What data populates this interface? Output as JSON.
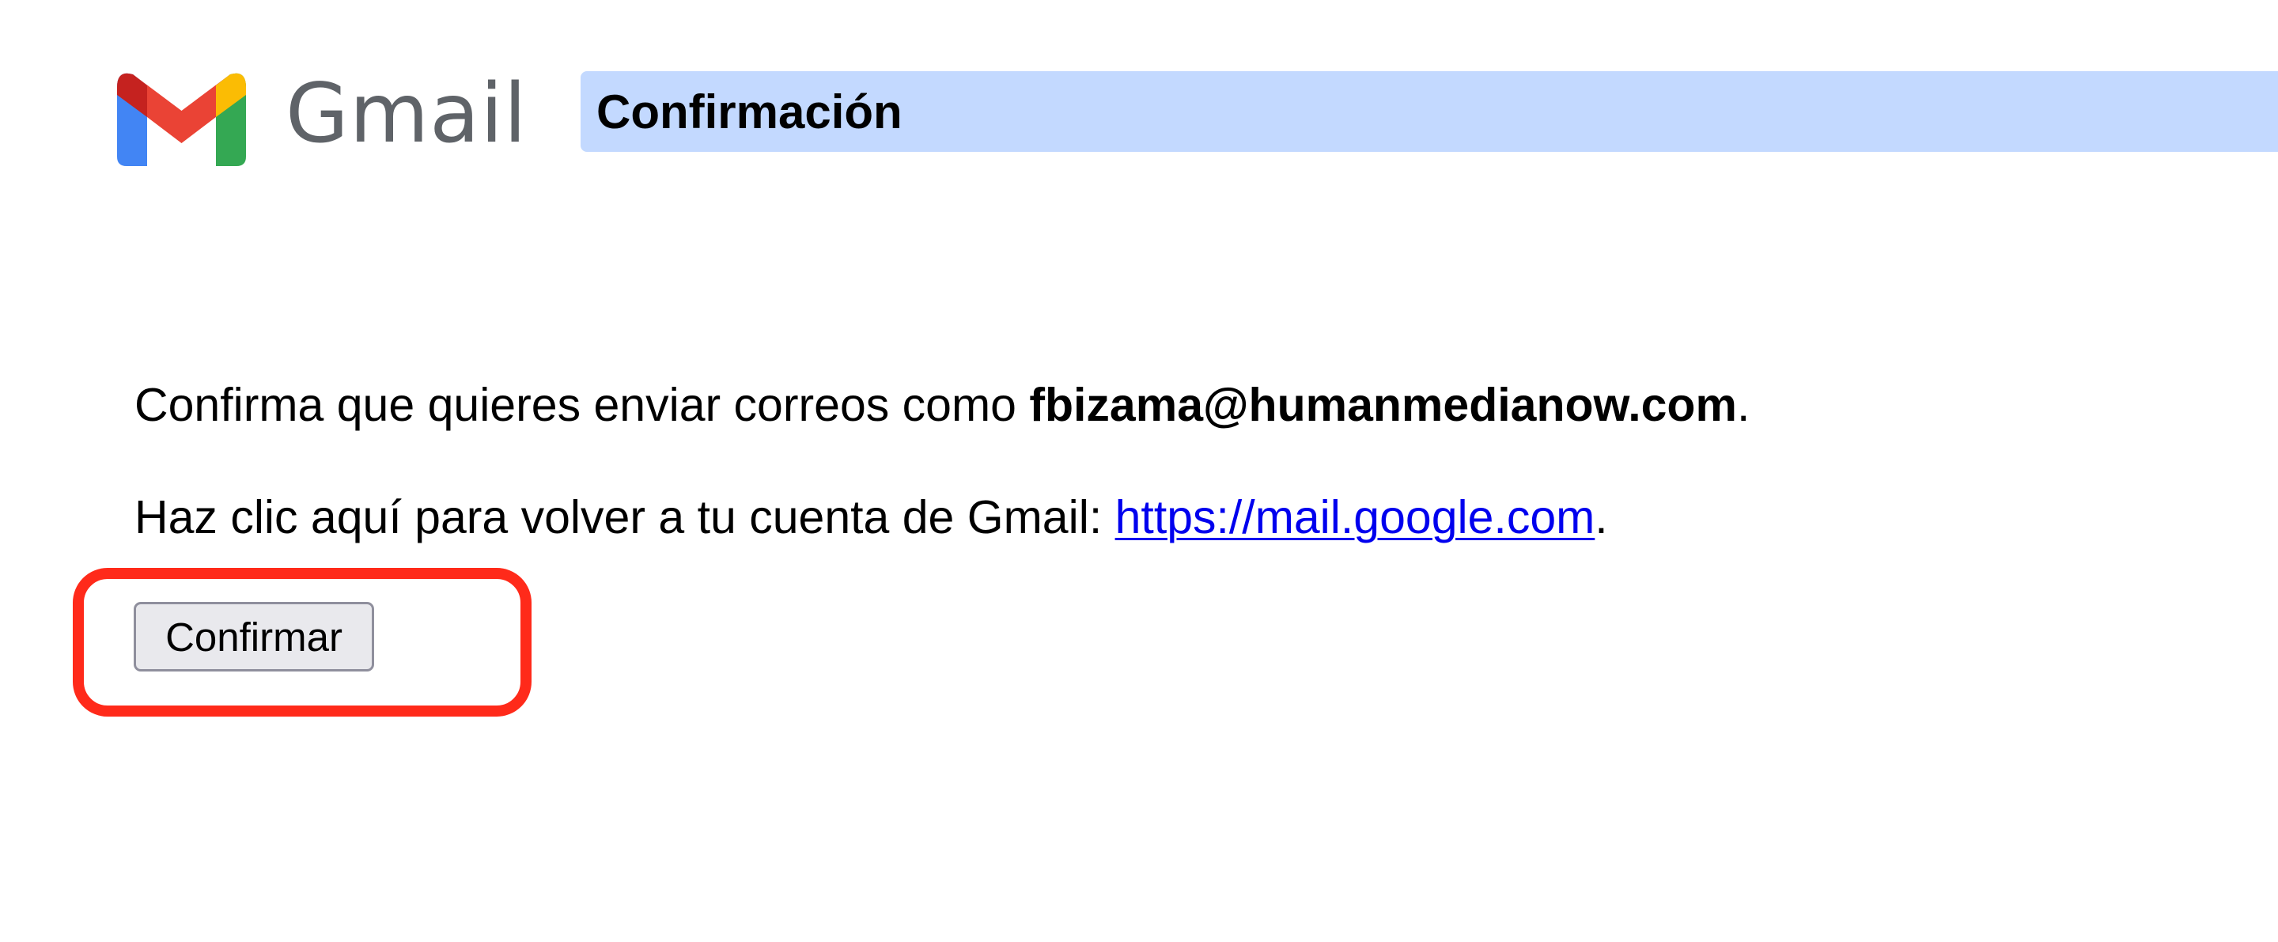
{
  "brand": {
    "name": "Gmail",
    "icon": "gmail-m-icon",
    "colors": {
      "blue": "#4285f4",
      "red": "#ea4335",
      "dark_red": "#c5221f",
      "yellow": "#fbbc04",
      "green": "#34a853",
      "wordmark": "#5f6368"
    }
  },
  "header": {
    "title": "Confirmación",
    "bar_color": "#c3d9ff"
  },
  "message": {
    "confirm_prefix": "Confirma que quieres enviar correos como ",
    "email": "fbizama@humanmedianow.com",
    "confirm_suffix": ".",
    "back_prefix": "Haz clic aquí para volver a tu cuenta de Gmail: ",
    "link_text": "https://mail.google.com",
    "back_suffix": "."
  },
  "actions": {
    "confirm_label": "Confirmar"
  },
  "annotation": {
    "highlight_color": "#ff2a1a"
  }
}
